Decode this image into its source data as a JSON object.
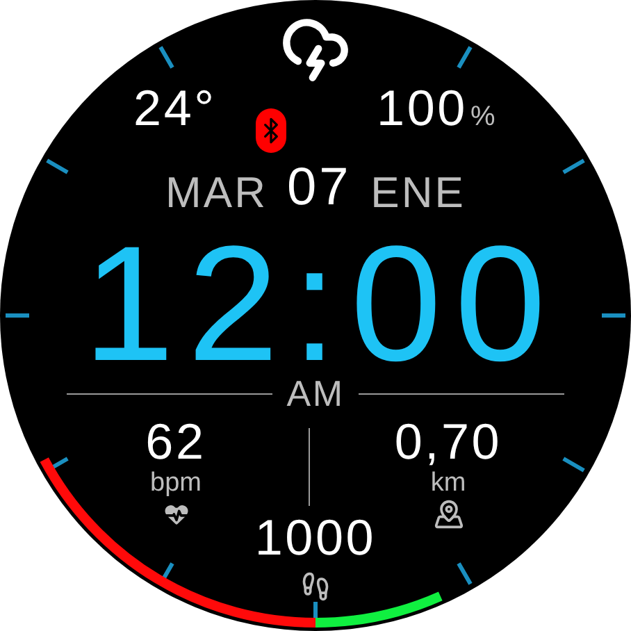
{
  "weather": {
    "temperature": "24°"
  },
  "bluetooth": {
    "on": true
  },
  "battery": {
    "value": "100",
    "unit": "%"
  },
  "date": {
    "weekday": "MAR",
    "day": "07",
    "month": "ENE"
  },
  "time": {
    "clock": "12:00",
    "period": "AM"
  },
  "heart_rate": {
    "value": "62",
    "unit": "bpm"
  },
  "distance": {
    "value": "0,70",
    "unit": "km"
  },
  "steps": {
    "value": "1000"
  }
}
